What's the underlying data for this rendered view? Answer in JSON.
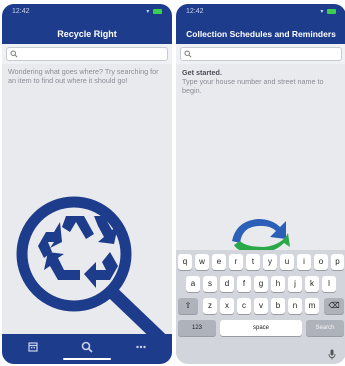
{
  "left_screen": {
    "status_time": "12:42",
    "title": "Recycle Right",
    "search_placeholder": "",
    "hint": "Wondering what goes where? Try searching for an item to find out where it should go!",
    "tabs": [
      {
        "icon": "calendar-icon"
      },
      {
        "icon": "search-icon"
      },
      {
        "icon": "more-icon"
      }
    ]
  },
  "right_screen": {
    "status_time": "12:42",
    "title": "Collection Schedules and Reminders",
    "search_placeholder": "",
    "get_started": "Get started.",
    "instructions": "Type your house number and street name to begin.",
    "keyboard": {
      "row1": [
        "q",
        "w",
        "e",
        "r",
        "t",
        "y",
        "u",
        "i",
        "o",
        "p"
      ],
      "row2": [
        "a",
        "s",
        "d",
        "f",
        "g",
        "h",
        "j",
        "k",
        "l"
      ],
      "row3": [
        "z",
        "x",
        "c",
        "v",
        "b",
        "n",
        "m"
      ],
      "numbers_label": "123",
      "space_label": "space",
      "search_label": "Search"
    }
  },
  "colors": {
    "brand_navy": "#1e3c8c",
    "logo_green": "#2aa84a",
    "logo_blue": "#2b5fb8"
  }
}
